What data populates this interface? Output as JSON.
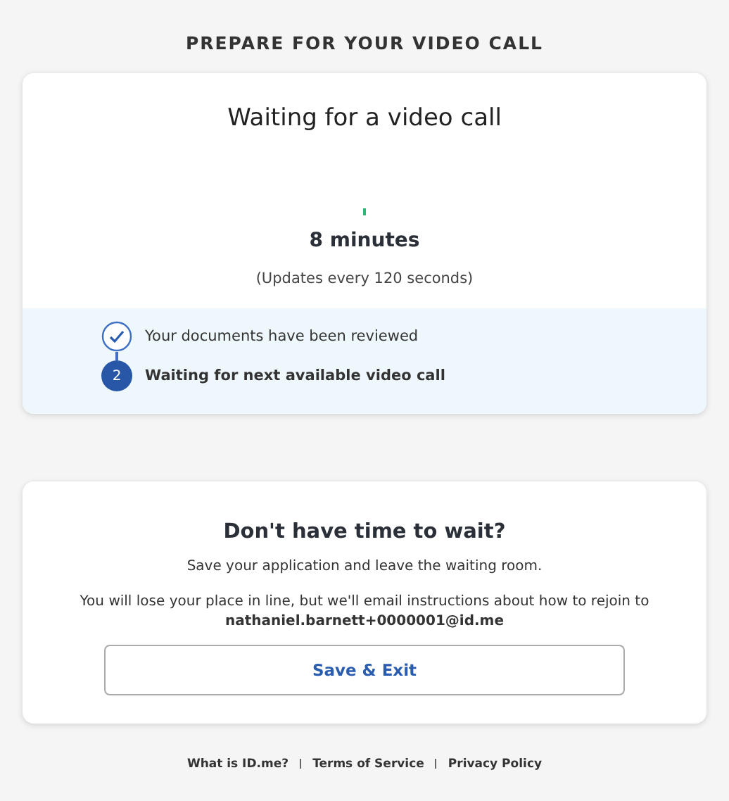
{
  "header": {
    "title": "PREPARE FOR YOUR VIDEO CALL"
  },
  "status_card": {
    "title": "Waiting for a video call",
    "wait_time": "8 minutes",
    "update_note": "(Updates every 120 seconds)",
    "steps": [
      {
        "kind": "done",
        "label": "Your documents have been reviewed"
      },
      {
        "kind": "current",
        "marker": "2",
        "label": "Waiting for next available video call"
      }
    ]
  },
  "leave_card": {
    "title": "Don't have time to wait?",
    "text": "Save your application and leave the waiting room.",
    "notice": "You will lose your place in line, but we'll email instructions about how to rejoin to **nathaniel.barnett+0000001@id.me**",
    "button": "Save & Exit"
  },
  "footer": {
    "links": [
      "What is ID.me?",
      "Terms of Service",
      "Privacy Policy"
    ]
  }
}
